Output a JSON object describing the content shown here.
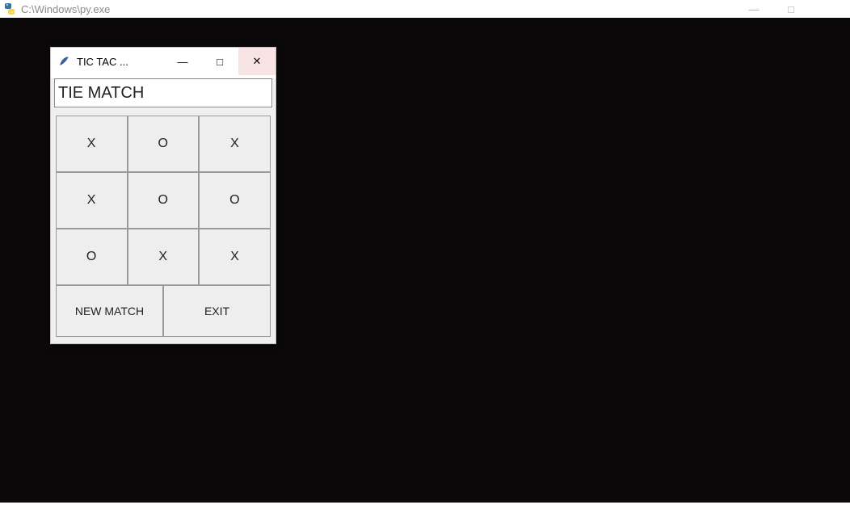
{
  "outer_window": {
    "title": "C:\\Windows\\py.exe",
    "minimize_glyph": "—",
    "maximize_glyph": "□",
    "close_glyph": "✕"
  },
  "tk_window": {
    "title": "TIC TAC ...",
    "minimize_glyph": "—",
    "maximize_glyph": "□",
    "close_glyph": "✕"
  },
  "status_text": "TIE MATCH",
  "board": {
    "r0c0": "X",
    "r0c1": "O",
    "r0c2": "X",
    "r1c0": "X",
    "r1c1": "O",
    "r1c2": "O",
    "r2c0": "O",
    "r2c1": "X",
    "r2c2": "X"
  },
  "buttons": {
    "new_match": "NEW MATCH",
    "exit": "EXIT"
  }
}
